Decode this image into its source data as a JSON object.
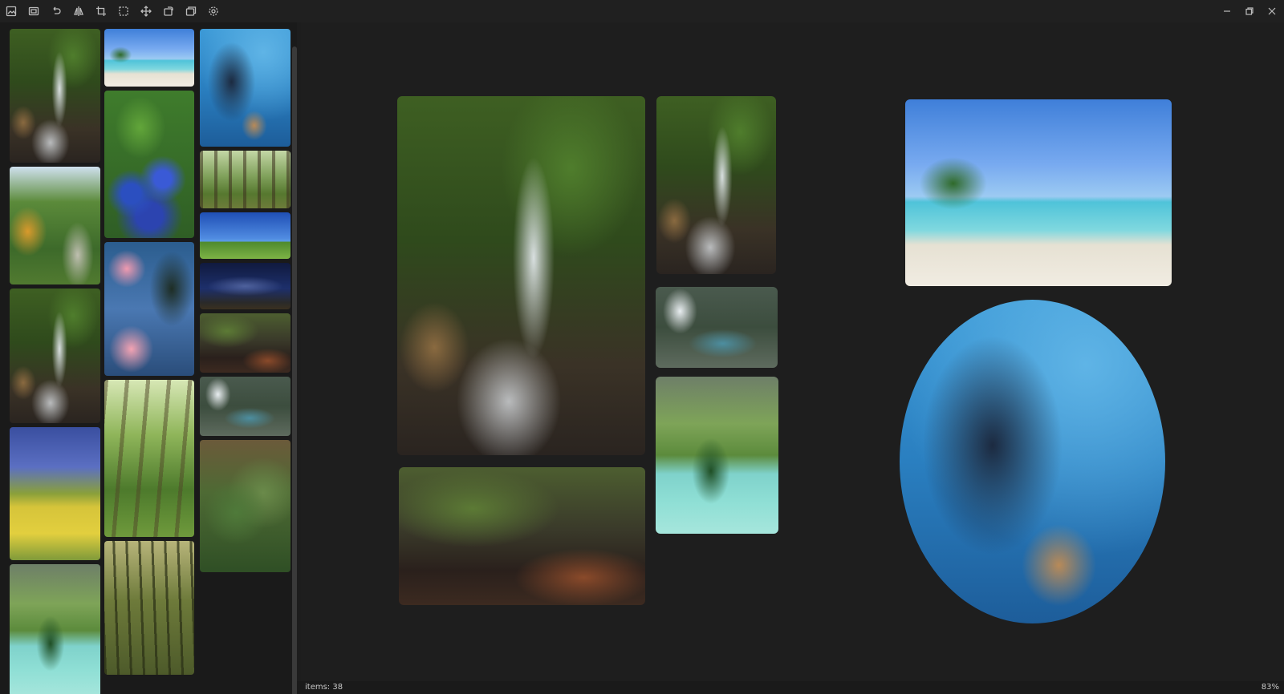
{
  "toolbar": {
    "icons": [
      "image-icon",
      "screenshot-icon",
      "undo-icon",
      "flip-icon",
      "crop-icon",
      "select-icon",
      "move-icon",
      "rotate-icon",
      "gallery-icon",
      "settings-icon"
    ]
  },
  "window_controls": [
    "minimize-icon",
    "restore-icon",
    "close-icon"
  ],
  "sidebar": {
    "thumbnails": [
      "waterfall",
      "beach",
      "coral-reef",
      "blue-flowers",
      "forest-path",
      "garden",
      "grass-field",
      "palm-trees",
      "night-sky",
      "waterfall-2",
      "woods",
      "creek",
      "cave-lagoon",
      "rapeseed-field",
      "leaves",
      "mountain-lake",
      "bamboo"
    ]
  },
  "canvas": {
    "photos": [
      "waterfall-large",
      "waterfall-small",
      "cave-lagoon",
      "mountain-lake",
      "forest-creek",
      "tropical-beach",
      "coral-reef-oval"
    ]
  },
  "statusbar": {
    "items_label": "items:",
    "items_count": "38",
    "zoom": "83%"
  }
}
